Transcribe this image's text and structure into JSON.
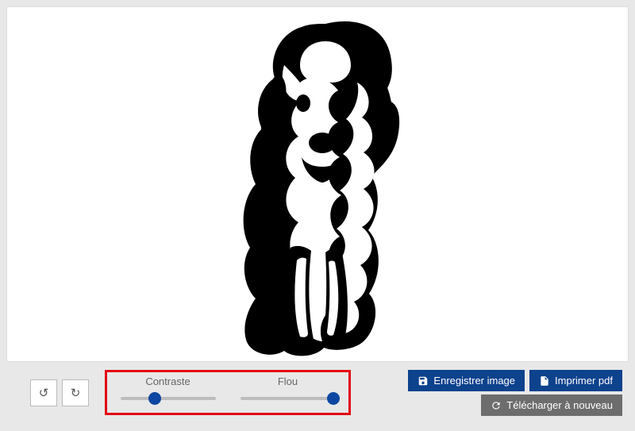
{
  "sliders": {
    "contrast": {
      "label": "Contraste",
      "value": 36
    },
    "blur": {
      "label": "Flou",
      "value": 98
    }
  },
  "buttons": {
    "save": "Enregistrer image",
    "print": "Imprimer pdf",
    "reupload": "Télécharger à nouveau"
  },
  "icons": {
    "undo": "↺",
    "redo": "↻"
  }
}
